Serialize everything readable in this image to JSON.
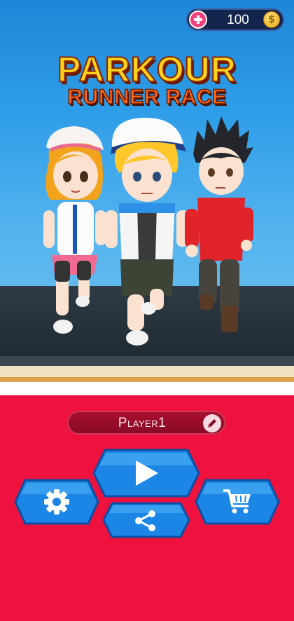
{
  "title": {
    "line1": "PARKOUR",
    "line2": "RUNNER RACE"
  },
  "currency": {
    "amount": "100",
    "add_icon": "plus-icon",
    "coin_icon": "coin-icon",
    "coin_symbol": "$"
  },
  "player": {
    "name": "Player1",
    "edit_icon": "pencil-icon"
  },
  "menu": {
    "play_icon": "play-icon",
    "settings_icon": "gear-icon",
    "share_icon": "share-icon",
    "shop_icon": "cart-icon"
  },
  "colors": {
    "panel": "#f0123e",
    "button_blue": "#1b86e6",
    "coin": "#f2b21a",
    "title_yellow": "#ffd21c",
    "title_orange": "#ff6a1c"
  }
}
